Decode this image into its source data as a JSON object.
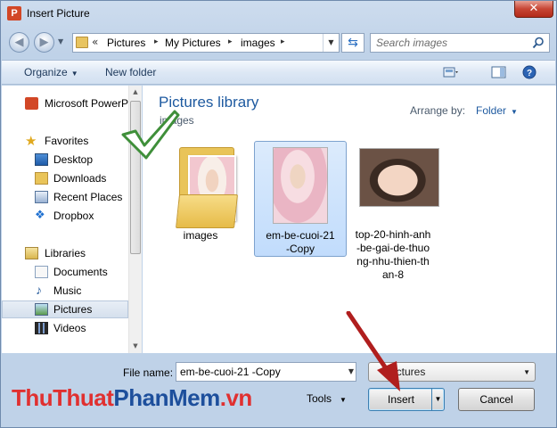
{
  "window": {
    "title": "Insert Picture",
    "app_icon_letter": "P",
    "close_glyph": "✕"
  },
  "address_bar": {
    "overflow_glyph": "«",
    "crumbs": [
      "Pictures",
      "My Pictures",
      "images"
    ],
    "separator": "▸"
  },
  "search": {
    "placeholder": "Search images"
  },
  "toolbar": {
    "organize_label": "Organize",
    "new_folder_label": "New folder"
  },
  "nav_pane": {
    "items": [
      {
        "label": "Microsoft PowerP",
        "icon": "powerpoint-icon"
      },
      {
        "label": "Favorites",
        "icon": "star-icon"
      },
      {
        "label": "Desktop",
        "icon": "desktop-icon"
      },
      {
        "label": "Downloads",
        "icon": "downloads-icon"
      },
      {
        "label": "Recent Places",
        "icon": "recent-places-icon"
      },
      {
        "label": "Dropbox",
        "icon": "dropbox-icon"
      },
      {
        "label": "Libraries",
        "icon": "libraries-icon"
      },
      {
        "label": "Documents",
        "icon": "documents-icon"
      },
      {
        "label": "Music",
        "icon": "music-icon"
      },
      {
        "label": "Pictures",
        "icon": "pictures-icon",
        "selected": true
      },
      {
        "label": "Videos",
        "icon": "videos-icon"
      }
    ]
  },
  "content": {
    "library_title": "Pictures library",
    "library_subtitle": "images",
    "arrange_label": "Arrange by:",
    "arrange_value": "Folder",
    "files": [
      {
        "name": "images",
        "type": "folder"
      },
      {
        "name_lines": [
          "em-be-cuoi-21",
          "-Copy"
        ],
        "type": "image",
        "selected": true
      },
      {
        "name_lines": [
          "top-20-hinh-anh",
          "-be-gai-de-thuo",
          "ng-nhu-thien-th",
          "an-8"
        ],
        "type": "image"
      }
    ]
  },
  "footer": {
    "file_name_label": "File name:",
    "file_name_value": "em-be-cuoi-21 -Copy",
    "file_type_value": "Pictures",
    "tools_label": "Tools",
    "insert_label": "Insert",
    "cancel_label": "Cancel"
  },
  "watermark": {
    "part1": "Thu",
    "part2": "Thuat",
    "part3": "PhanMem",
    "part4": ".vn"
  },
  "colors": {
    "accent_blue": "#1e5aa0",
    "selection": "#c1dcfc",
    "arrow_red": "#b01e1e",
    "check_green": "#3f8f3a"
  }
}
